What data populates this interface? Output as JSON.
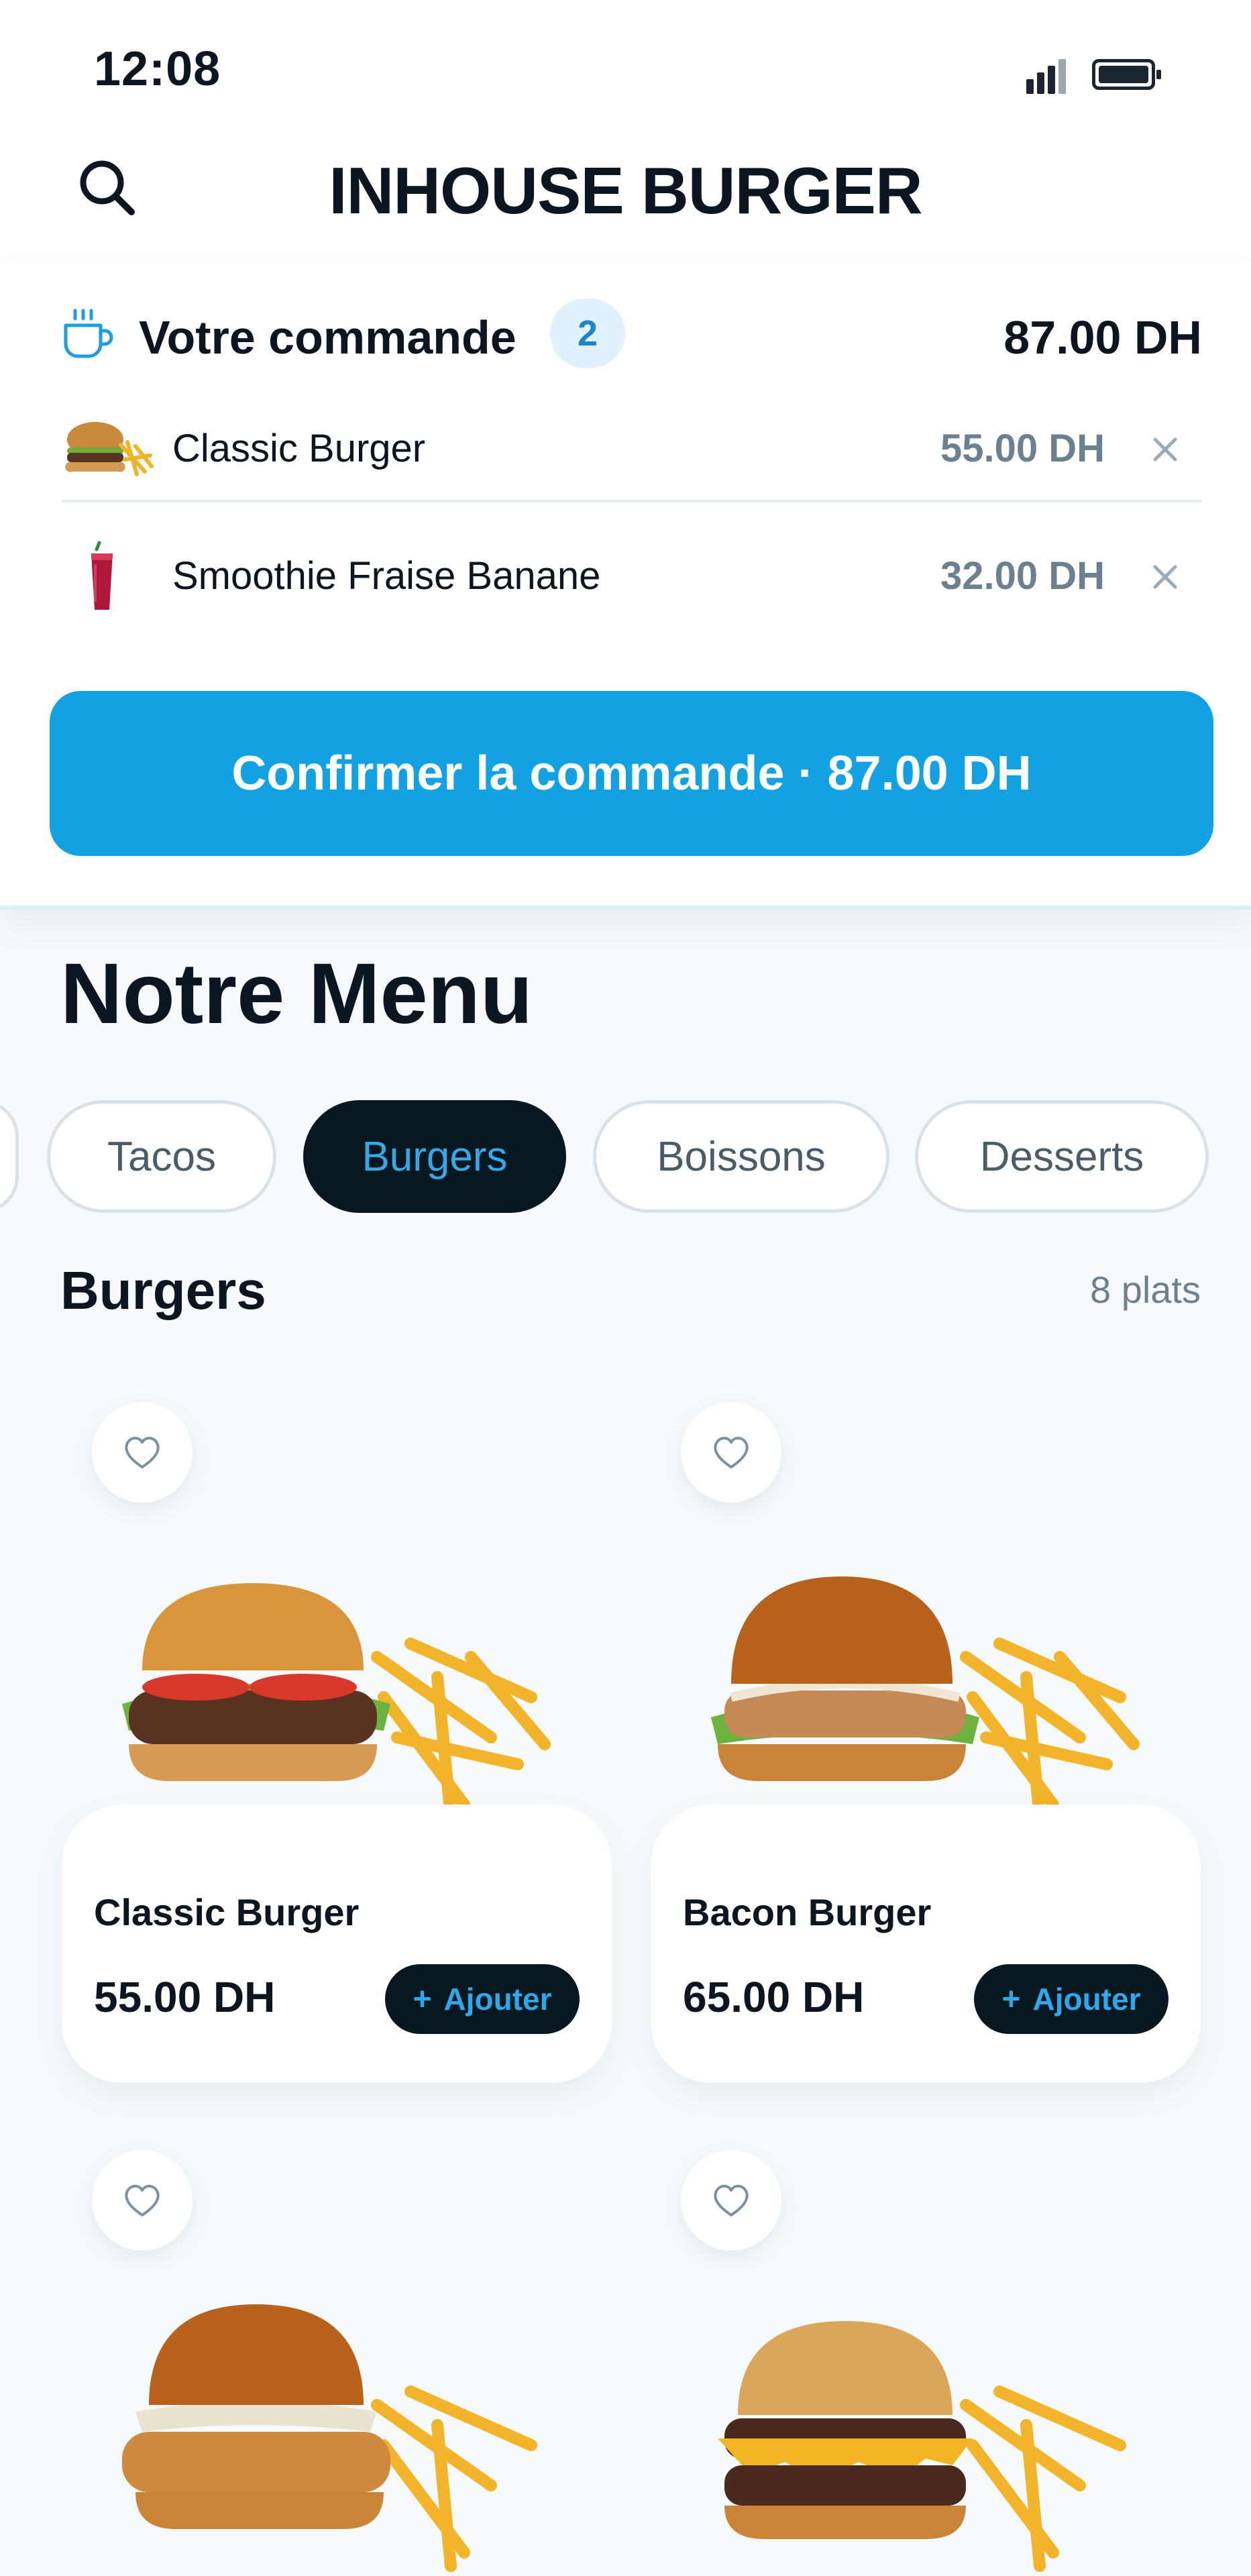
{
  "status_bar": {
    "time": "12:08"
  },
  "header": {
    "title": "INHOUSE BURGER"
  },
  "order": {
    "title": "Votre commande",
    "count": "2",
    "total": "87.00 DH",
    "items": [
      {
        "name": "Classic Burger",
        "price": "55.00 DH"
      },
      {
        "name": "Smoothie Fraise Banane",
        "price": "32.00 DH"
      }
    ],
    "confirm_label": "Confirmer la commande · 87.00 DH"
  },
  "menu": {
    "title": "Notre Menu",
    "categories": [
      {
        "label": "Tacos",
        "active": false
      },
      {
        "label": "Burgers",
        "active": true
      },
      {
        "label": "Boissons",
        "active": false
      },
      {
        "label": "Desserts",
        "active": false
      }
    ],
    "section": {
      "title": "Burgers",
      "count": "8 plats"
    },
    "products": [
      {
        "name": "Classic Burger",
        "price": "55.00 DH",
        "add_label": "Ajouter"
      },
      {
        "name": "Bacon Burger",
        "price": "65.00 DH",
        "add_label": "Ajouter"
      }
    ]
  },
  "colors": {
    "accent": "#12a2e4",
    "dark": "#081820",
    "muted": "#6c8190"
  },
  "icons": [
    "search-icon",
    "cup-icon",
    "close-icon",
    "heart-icon",
    "plus-icon",
    "signal-icon",
    "battery-icon"
  ]
}
